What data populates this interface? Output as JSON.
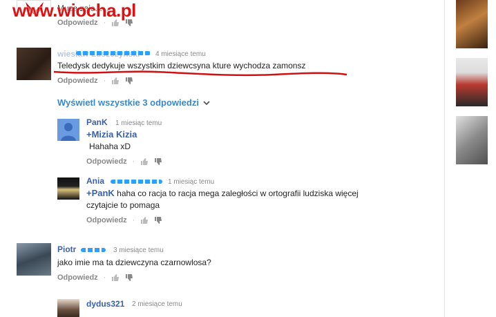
{
  "watermark": "www.wiocha.pl",
  "top_comment": {
    "text": "Muza zaje......",
    "reply_label": "Odpowiedz"
  },
  "comment_main": {
    "author": "wiesław Łuszczyński",
    "time": "4 miesiące temu",
    "text": "Teledysk dedykuje wszystkim dziewcsyna kture wychodza zamonsz",
    "reply_label": "Odpowiedz"
  },
  "show_all_label": "Wyświetl wszystkie 3 odpowiedzi",
  "replies": [
    {
      "author": "PanK",
      "time": "1 miesiąc temu",
      "mention": "+Mizia Kizia",
      "text": "Hahaha xD",
      "reply_label": "Odpowiedz"
    },
    {
      "author": "Ania",
      "time": "1 miesiąc temu",
      "mention": "+PanK",
      "text_line1": "haha co racja to racja  mega  zaległości w ortografii ludziska więcej",
      "text_line2": "czytajcie to pomaga",
      "reply_label": "Odpowiedz"
    }
  ],
  "comment_piotr": {
    "author": "Piotr",
    "time": "3 miesiące temu",
    "text": "jako imie ma ta dziewczyna czarnowlosa?",
    "reply_label": "Odpowiedz"
  },
  "comment_dydus": {
    "author": "dydus321",
    "time": "2 miesiące temu"
  },
  "icons": {
    "like": "thumbs-up-icon",
    "dislike": "thumbs-down-icon",
    "chevron": "chevron-down-icon"
  },
  "colors": {
    "author_blue": "#3a5fa8",
    "link_blue": "#3a88c9",
    "underline_red": "#d11111",
    "redaction_blue": "#2ba0ff"
  }
}
